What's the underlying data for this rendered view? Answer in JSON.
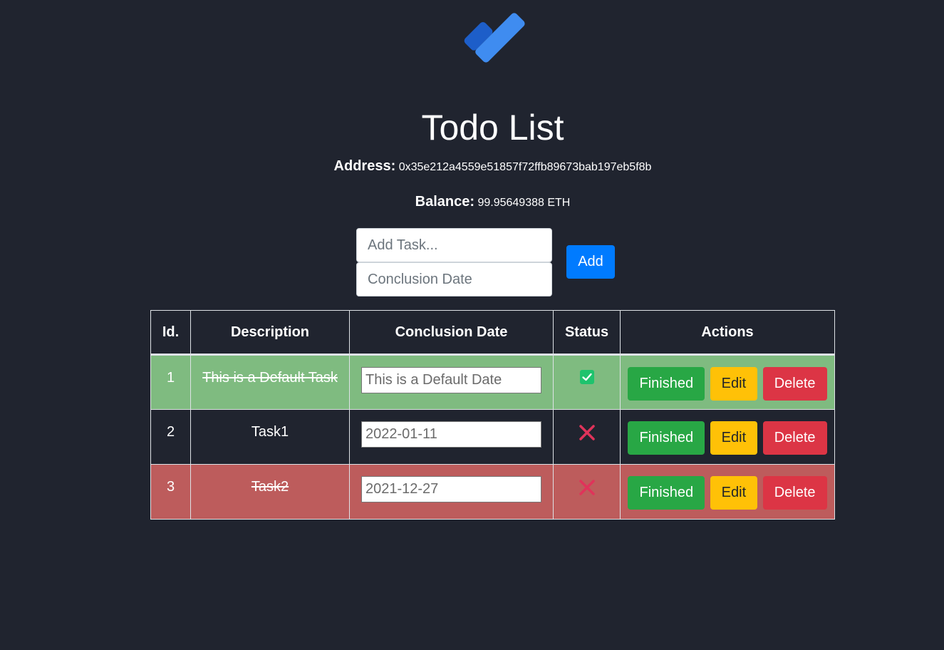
{
  "app": {
    "logo_icon": "checkmark-logo-icon",
    "title": "Todo List"
  },
  "account": {
    "address_label": "Address:",
    "address_value": "0x35e212a4559e51857f72ffb89673bab197eb5f8b",
    "balance_label": "Balance:",
    "balance_value": "99.95649388 ETH"
  },
  "form": {
    "task_placeholder": "Add Task...",
    "date_placeholder": "Conclusion Date",
    "add_label": "Add"
  },
  "table": {
    "headers": [
      "Id.",
      "Description",
      "Conclusion Date",
      "Status",
      "Actions"
    ],
    "rows": [
      {
        "id": "1",
        "description": "This is a Default Task",
        "date": "This is a Default Date",
        "status": "done",
        "status_icon": "check-icon"
      },
      {
        "id": "2",
        "description": "Task1",
        "date": "2022-01-11",
        "status": "pending",
        "status_icon": "x-icon"
      },
      {
        "id": "3",
        "description": "Task2",
        "date": "2021-12-27",
        "status": "late",
        "status_icon": "x-icon"
      }
    ],
    "actions": {
      "finished_label": "Finished",
      "edit_label": "Edit",
      "delete_label": "Delete"
    }
  },
  "colors": {
    "background": "#20242f",
    "row_done": "#7fbb80",
    "row_late": "#bd5c5c",
    "add_button": "#007bff",
    "finished_button": "#28a745",
    "edit_button": "#ffc107",
    "delete_button": "#dc3545",
    "x_icon": "#e0335a",
    "check_icon": "#1ec36d"
  }
}
